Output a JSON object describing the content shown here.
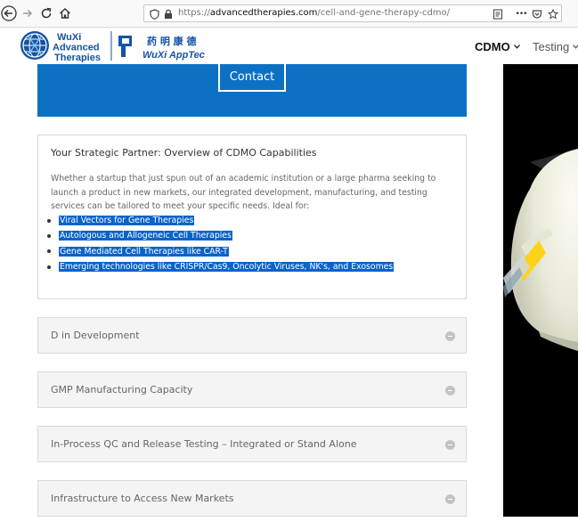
{
  "browser": {
    "url_scheme": "https://",
    "url_host": "advancedtherapies.com",
    "url_path": "/cell-and-gene-therapy-cdmo/",
    "menu_ellipsis": "•••"
  },
  "header": {
    "logo": {
      "line1": "WuXi",
      "line2": "Advanced",
      "line3": "Therapies",
      "chinese": "药 明 康 德",
      "apptec": "WuXi AppTec"
    },
    "nav": [
      {
        "label": "CDMO"
      },
      {
        "label": "Testing"
      }
    ]
  },
  "hero": {
    "contact_label": "Contact"
  },
  "panel": {
    "title": "Your Strategic Partner: Overview of CDMO Capabilities",
    "body": "Whether a startup that just spun out of an academic institution or a large pharma seeking to launch a product in new markets, our integrated development, manufacturing, and testing services can be tailored to meet your specific needs. Ideal for:",
    "items": [
      "Viral Vectors for Gene Therapies",
      "Autologous and Allogeneic Cell Therapies",
      "Gene Mediated Cell Therapies like CAR-T",
      "Emerging technologies like CRISPR/Cas9, Oncolytic Viruses, NK's, and Exosomes"
    ]
  },
  "accordions": [
    "D in Development",
    "GMP Manufacturing Capacity",
    "In-Process QC and Release Testing – Integrated or Stand Alone",
    "Infrastructure to Access New Markets"
  ],
  "colors": {
    "brand_blue": "#0c71c3",
    "selection_blue": "#0a63c9",
    "wuxi_blue": "#1553a5"
  }
}
